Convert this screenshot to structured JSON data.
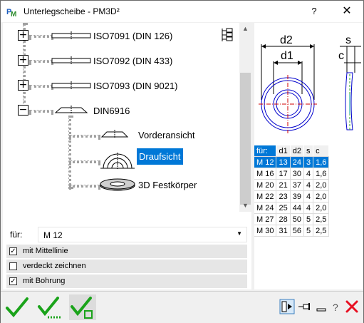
{
  "window": {
    "title": "Unterlegscheibe  -  PM3D²",
    "help_label": "?",
    "close_label": "✕",
    "app_icon": "pm3d-app-icon"
  },
  "tree": {
    "items": [
      {
        "label": "ISO7091 (DIN 126)",
        "expander": "+"
      },
      {
        "label": "ISO7092 (DIN 433)",
        "expander": "+"
      },
      {
        "label": "ISO7093 (DIN 9021)",
        "expander": "+"
      },
      {
        "label": "DIN6916",
        "expander": "−"
      }
    ],
    "children": [
      {
        "label": "Vorderansicht",
        "selected": false
      },
      {
        "label": "Draufsicht",
        "selected": true
      },
      {
        "label": "3D Festkörper",
        "selected": false
      }
    ]
  },
  "options": {
    "for_label": "für:",
    "for_value": "M 12",
    "checks": [
      {
        "label": "mit Mittellinie",
        "checked": true
      },
      {
        "label": "verdeckt zeichnen",
        "checked": false
      },
      {
        "label": "mit Bohrung",
        "checked": true
      }
    ]
  },
  "drawing": {
    "labels": {
      "d2": "d2",
      "d1": "d1",
      "s": "s",
      "c": "c"
    }
  },
  "table": {
    "headers": [
      "für:",
      "d1",
      "d2",
      "s",
      "c"
    ],
    "rows": [
      [
        "M 12",
        "13",
        "24",
        "3",
        "1,6"
      ],
      [
        "M 16",
        "17",
        "30",
        "4",
        "1,6"
      ],
      [
        "M 20",
        "21",
        "37",
        "4",
        "2,0"
      ],
      [
        "M 22",
        "23",
        "39",
        "4",
        "2,0"
      ],
      [
        "M 24",
        "25",
        "44",
        "4",
        "2,0"
      ],
      [
        "M 27",
        "28",
        "50",
        "5",
        "2,5"
      ],
      [
        "M 30",
        "31",
        "56",
        "5",
        "2,5"
      ]
    ],
    "selected_row": 0
  },
  "colors": {
    "selection": "#0078d7",
    "check_green": "#1aa31a",
    "close_red": "#e81123",
    "washer_blue": "#0000cc",
    "centerline_red": "#d00000"
  },
  "bottombar": {
    "icons": [
      "ok-check-icon",
      "ok-repeat-icon",
      "ok-place-icon",
      "dock-icon",
      "pin-icon",
      "minimize-icon",
      "help-icon",
      "cancel-icon"
    ]
  }
}
